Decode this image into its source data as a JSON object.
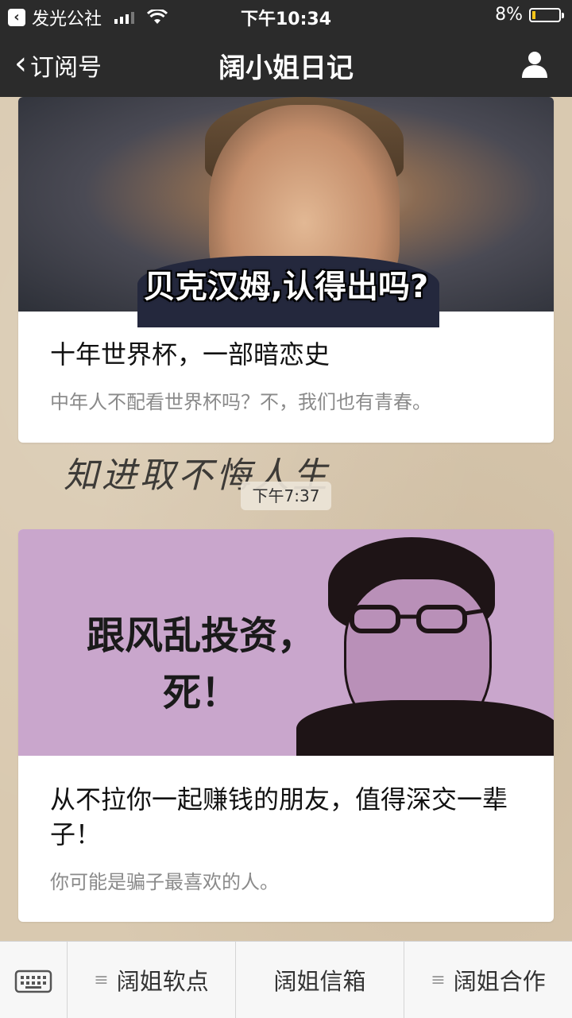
{
  "status_bar": {
    "back_app": "发光公社",
    "time": "下午10:34",
    "battery": "8%"
  },
  "nav": {
    "back_label": "订阅号",
    "title": "阔小姐日记",
    "user_icon": "person-icon"
  },
  "articles": [
    {
      "cover_caption": "贝克汉姆,认得出吗?",
      "title": "十年世界杯，一部暗恋史",
      "summary": "中年人不配看世界杯吗？不，我们也有青春。"
    },
    {
      "cover_text": "跟风乱投资，死！",
      "title": "从不拉你一起赚钱的朋友，值得深交一辈子！",
      "summary": "你可能是骗子最喜欢的人。"
    }
  ],
  "background_text": "知进取不悔人生",
  "timestamp": "下午7:37",
  "bottom_menu": {
    "keyboard_icon": "keyboard-icon",
    "items": [
      "阔姐软点",
      "阔姐信箱",
      "阔姐合作"
    ]
  }
}
